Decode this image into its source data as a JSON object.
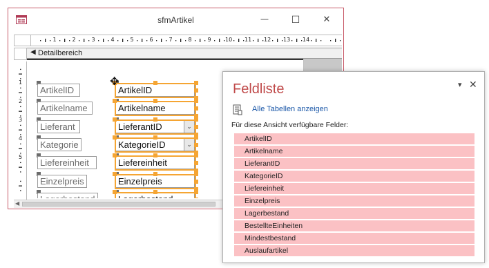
{
  "window": {
    "title": "sfmArtikel",
    "minimize_glyph": "—",
    "maximize_glyph": "☐",
    "close_glyph": "✕"
  },
  "ruler": {
    "horizontal_numbers": [
      "1",
      "2",
      "3",
      "4",
      "5",
      "6",
      "7",
      "8",
      "9",
      "10",
      "11",
      "12",
      "13",
      "14"
    ],
    "vertical_numbers": [
      "1",
      "2",
      "3",
      "4",
      "5"
    ]
  },
  "section": {
    "arrow": "◀",
    "label": "Detailbereich"
  },
  "form": {
    "labels": [
      "ArtikelID",
      "Artikelname",
      "Lieferant",
      "Kategorie",
      "Liefereinheit",
      "Einzelpreis",
      "Lagerbestand"
    ],
    "fields": [
      "ArtikelID",
      "Artikelname",
      "LieferantID",
      "KategorieID",
      "Liefereinheit",
      "Einzelpreis",
      "Lagerbestand"
    ],
    "combo_glyph": "⌄"
  },
  "cursor": {
    "icon": "move-cursor-icon",
    "glyph": "✥"
  },
  "fieldlist": {
    "title": "Feldliste",
    "dropdown_glyph": "▾",
    "close_glyph": "✕",
    "show_all_link": "Alle Tabellen anzeigen",
    "caption": "Für diese Ansicht verfügbare Felder:",
    "items": [
      "ArtikelID",
      "Artikelname",
      "LieferantID",
      "KategorieID",
      "Liefereinheit",
      "Einzelpreis",
      "Lagerbestand",
      "BestellteEinheiten",
      "Mindestbestand",
      "Auslaufartikel"
    ]
  },
  "colors": {
    "window_border": "#c85a68",
    "selection": "#f5a533",
    "pane_title": "#c04a4a",
    "field_item_bg": "#fbc1c4",
    "link": "#1a57a8"
  }
}
